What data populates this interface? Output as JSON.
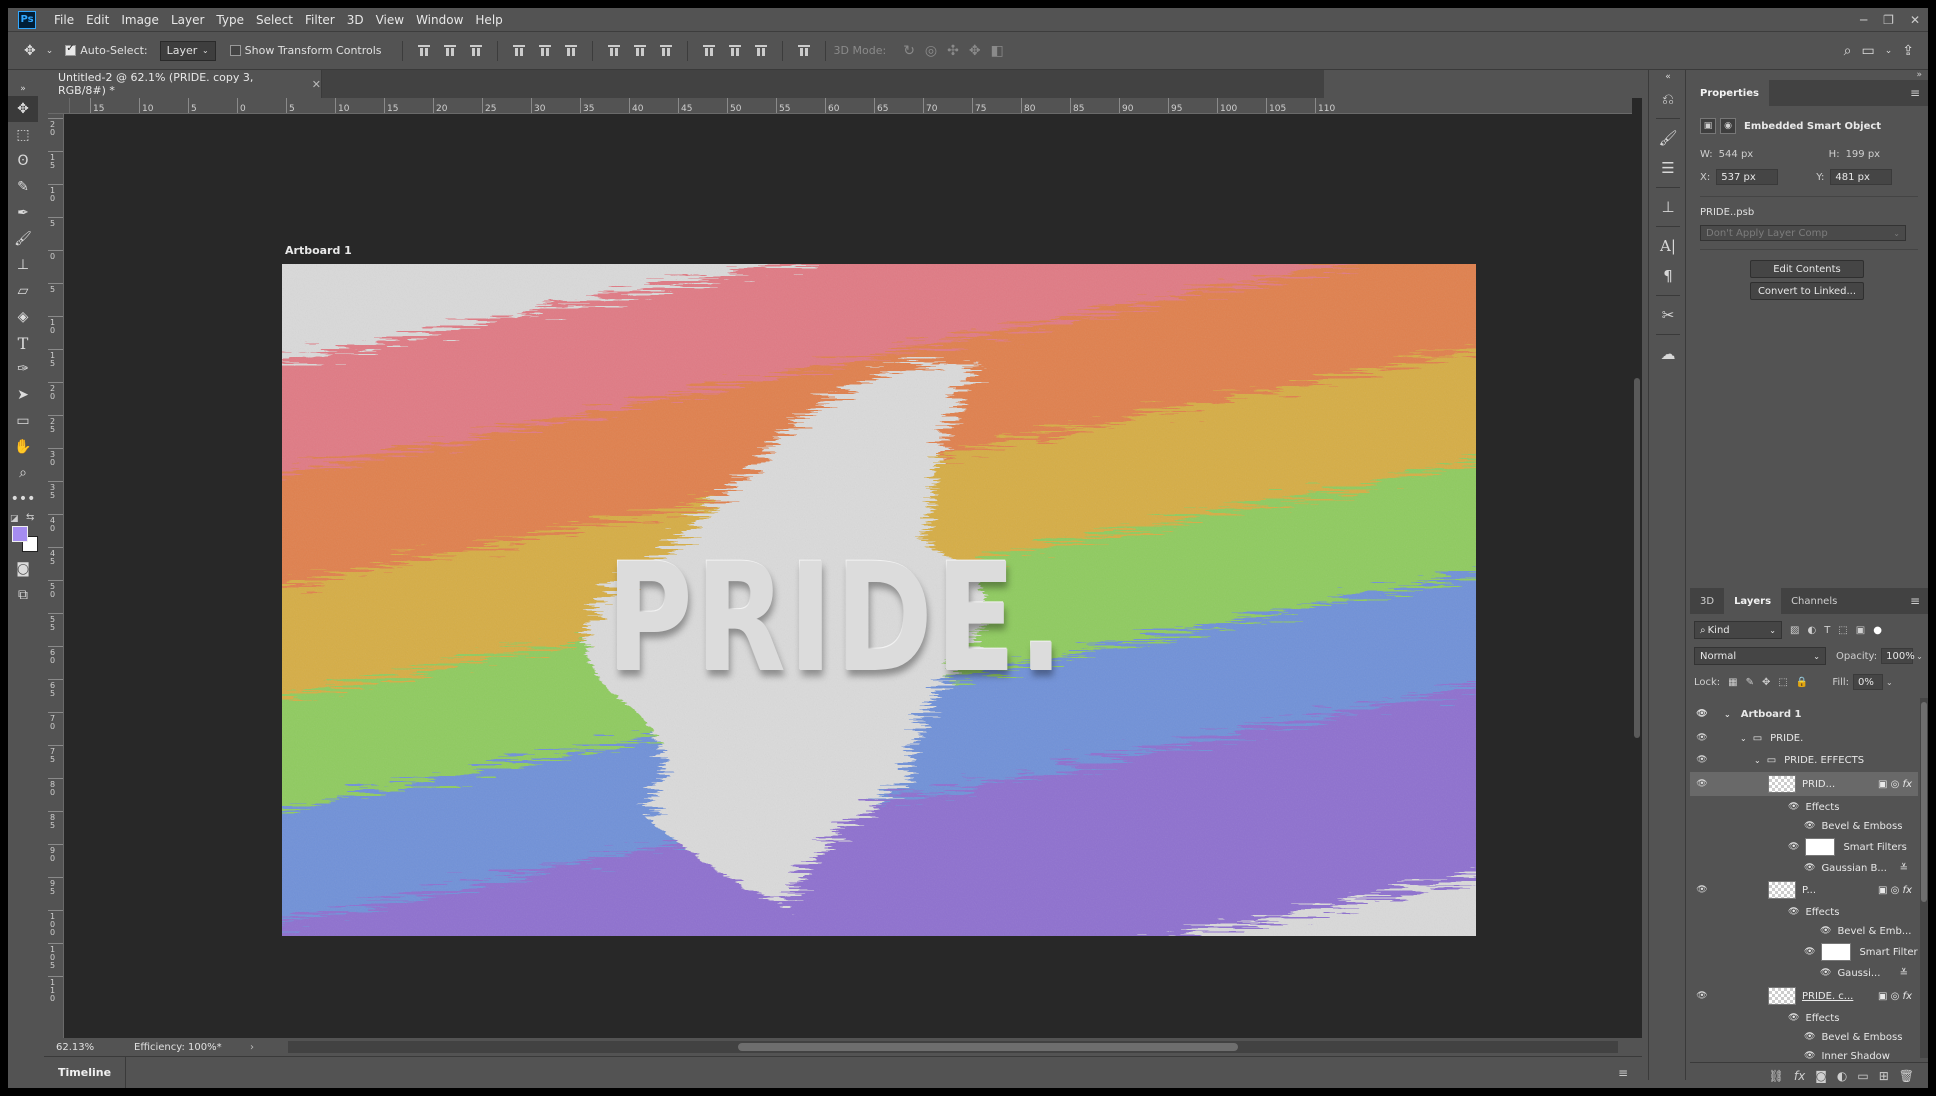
{
  "menubar": {
    "logo": "Ps",
    "items": [
      "File",
      "Edit",
      "Image",
      "Layer",
      "Type",
      "Select",
      "Filter",
      "3D",
      "View",
      "Window",
      "Help"
    ]
  },
  "options": {
    "auto_select_label": "Auto-Select:",
    "auto_select_value": "Layer",
    "transform_label": "Show Transform Controls",
    "mode_3d_label": "3D Mode:"
  },
  "document": {
    "tab_title": "Untitled-2 @ 62.1% (PRIDE. copy 3, RGB/8#) *",
    "artboard_label": "Artboard 1",
    "canvas_text": "PRIDE.",
    "zoom": "62.13%",
    "efficiency": "Efficiency: 100%*"
  },
  "ruler": {
    "h_labels": [
      "15",
      "10",
      "5",
      "0",
      "5",
      "10",
      "15",
      "20",
      "25",
      "30",
      "35",
      "40",
      "45",
      "50",
      "55",
      "60",
      "65",
      "70",
      "75",
      "80",
      "85",
      "90",
      "95",
      "100",
      "105",
      "110"
    ],
    "v_labels": [
      "2 0",
      "1 5",
      "1 0",
      "5",
      "0",
      "5",
      "1 0",
      "1 5",
      "2 0",
      "2 5",
      "3 0",
      "3 5",
      "4 0",
      "4 5",
      "5 0",
      "5 5",
      "6 0",
      "6 5",
      "7 0",
      "7 5",
      "8 0",
      "8 5",
      "9 0",
      "9 5",
      "1 0 0",
      "1 0 5",
      "1 1 0"
    ]
  },
  "timeline": {
    "label": "Timeline"
  },
  "properties": {
    "tab": "Properties",
    "type_label": "Embedded Smart Object",
    "w_label": "W:",
    "w_value": "544 px",
    "h_label": "H:",
    "h_value": "199 px",
    "x_label": "X:",
    "x_value": "537 px",
    "y_label": "Y:",
    "y_value": "481 px",
    "file_name": "PRIDE..psb",
    "layer_comp": "Don't Apply Layer Comp",
    "edit_contents": "Edit Contents",
    "convert_linked": "Convert to Linked..."
  },
  "layers_panel": {
    "tabs": [
      "3D",
      "Layers",
      "Channels"
    ],
    "kind_label": "Kind",
    "blend_mode": "Normal",
    "opacity_label": "Opacity:",
    "opacity_value": "100%",
    "lock_label": "Lock:",
    "fill_label": "Fill:",
    "fill_value": "0%",
    "rows": [
      {
        "label": "Artboard 1"
      },
      {
        "label": "PRIDE."
      },
      {
        "label": "PRIDE. EFFECTS"
      },
      {
        "label": "PRID..."
      },
      {
        "label": "Effects"
      },
      {
        "label": "Bevel & Emboss"
      },
      {
        "label": "Smart Filters"
      },
      {
        "label": "Gaussian B..."
      },
      {
        "label": "P..."
      },
      {
        "label": "Effects"
      },
      {
        "label": "Bevel & Emb..."
      },
      {
        "label": "Smart Filter"
      },
      {
        "label": "Gaussi..."
      },
      {
        "label": "PRIDE. c..."
      },
      {
        "label": "Effects"
      },
      {
        "label": "Bevel & Emboss"
      },
      {
        "label": "Inner Shadow"
      }
    ]
  },
  "colors": {
    "rainbow": [
      "#e07a84",
      "#e0804e",
      "#d6ad45",
      "#8fcb5f",
      "#6f91d8",
      "#8e6fcf"
    ],
    "foreground": "#a58cf0",
    "background": "#ffffff"
  }
}
